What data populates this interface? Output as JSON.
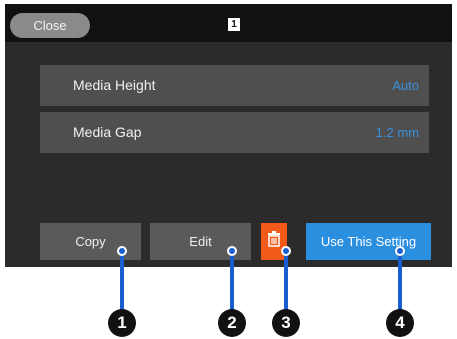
{
  "header": {
    "close_label": "Close",
    "page_indicator": "1"
  },
  "settings": [
    {
      "label": "Media Height",
      "value": "Auto"
    },
    {
      "label": "Media Gap",
      "value": "1.2 mm"
    }
  ],
  "buttons": {
    "copy_label": "Copy",
    "edit_label": "Edit",
    "delete_icon": "trash-icon",
    "use_label": "Use This Setting"
  },
  "callouts": [
    {
      "number": "1",
      "target": "Copy"
    },
    {
      "number": "2",
      "target": "Edit"
    },
    {
      "number": "3",
      "target": "Delete"
    },
    {
      "number": "4",
      "target": "Use This Setting"
    }
  ],
  "colors": {
    "value_text": "#3b8fdc",
    "delete_button": "#f25a1a",
    "use_button": "#2b8fe0",
    "callout": "#1a5fd1"
  }
}
